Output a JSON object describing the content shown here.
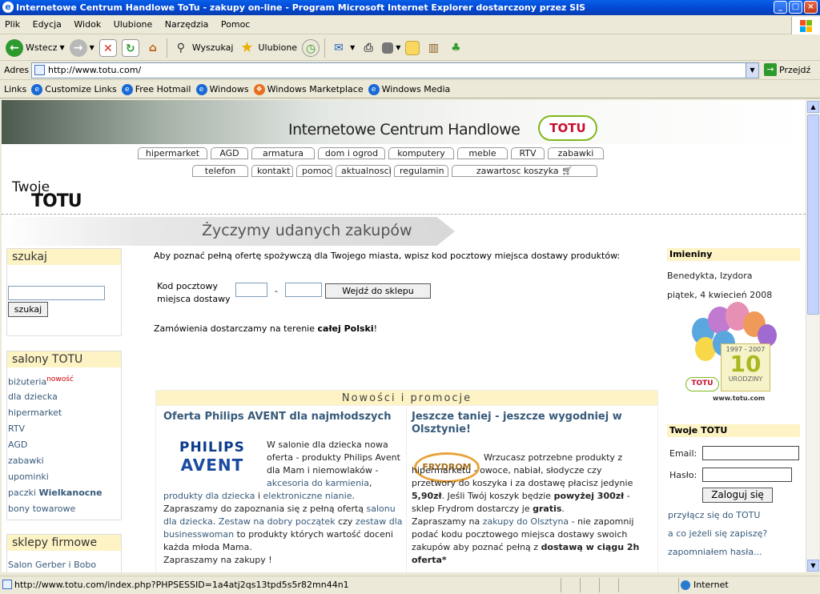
{
  "window": {
    "title": "Internetowe Centrum Handlowe ToTu - zakupy on-line - Program Microsoft Internet Explorer dostarczony przez SIS"
  },
  "menu": [
    "Plik",
    "Edycja",
    "Widok",
    "Ulubione",
    "Narzędzia",
    "Pomoc"
  ],
  "toolbar": {
    "back": "Wstecz",
    "search": "Wyszukaj",
    "favorites": "Ulubione"
  },
  "address": {
    "label": "Adres",
    "url": "http://www.totu.com/",
    "go": "Przejdź"
  },
  "links": {
    "label": "Links",
    "items": [
      "Customize Links",
      "Free Hotmail",
      "Windows",
      "Windows Marketplace",
      "Windows Media"
    ]
  },
  "header": {
    "title": "Internetowe Centrum Handlowe",
    "logo": "TOTU",
    "nav1": [
      "hipermarket",
      "AGD",
      "armatura",
      "dom i ogrod",
      "komputery",
      "meble",
      "RTV",
      "zabawki"
    ],
    "nav2": [
      "telefon",
      "kontakt",
      "pomoc",
      "aktualnosci",
      "regulamin",
      "zawartosc koszyka"
    ],
    "brand_top": "Twoje",
    "brand_bottom": "TOTU",
    "slogan": "Życzymy udanych zakupów"
  },
  "left": {
    "search_title": "szukaj",
    "search_button": "szukaj",
    "salons_title": "salony TOTU",
    "salons": [
      "biżuteria",
      "dla dziecka",
      "hipermarket",
      "RTV",
      "AGD",
      "zabawki",
      "upominki",
      "paczki",
      "bony towarowe"
    ],
    "new_badge": "nowość",
    "paczki_bold": "Wielkanocne",
    "stores_title": "sklepy firmowe",
    "stores": [
      "Salon Gerber i Bobo"
    ]
  },
  "center": {
    "intro": "Aby poznać pełną ofertę spożywczą dla Twojego miasta, wpisz kod pocztowy miejsca dostawy produktów:",
    "postal_label_1": "Kod pocztowy",
    "postal_label_2": "miejsca dostawy",
    "postal_sep": "-",
    "enter_button": "Wejdź do sklepu",
    "delivery_pre": "Zamówienia dostarczamy na terenie ",
    "delivery_bold": "całej Polski",
    "delivery_post": "!",
    "news_title": "Nowości i promocje",
    "news1_title": "Oferta Philips AVENT dla najmłodszych",
    "news1_logo1": "PHILIPS",
    "news1_logo2": "AVENT",
    "news1_text_a": "W salonie dla dziecka nowa oferta - produkty Philips Avent dla Mam i niemowlaków -",
    "news1_link_a": "akcesoria do karmienia",
    "news1_link_b": "produkty dla dziecka",
    "news1_link_c": "elektroniczne nianie",
    "news1_text_b": ". Zapraszamy do zapoznania się z pełną ofertą",
    "news1_link_d": "salonu dla dziecka",
    "news1_link_e": "Zestaw na dobry początek",
    "news1_text_c": "czy",
    "news1_link_f": "zestaw dla businesswoman",
    "news1_text_d": "to produkty których wartość doceni każda młoda Mama.",
    "news1_text_e": "Zapraszamy na zakupy !",
    "news2_title": "Jeszcze taniej - jeszcze wygodniej w Olsztynie!",
    "news2_logo": "FRYDROM",
    "news2_text_a": "Wrzucasz potrzebne produkty z hipermarketu - owoce, nabiał, słodycze czy przetwory do koszyka i za dostawę płacisz jedynie",
    "news2_price": "5,90zł",
    "news2_text_b": ". Jeśli Twój koszyk będzie",
    "news2_above": "powyżej 300zł",
    "news2_text_c": "- sklep Frydrom dostarczy je",
    "news2_free": "gratis",
    "news2_text_d": "Zapraszamy na",
    "news2_link": "zakupy do Olsztyna",
    "news2_text_e": "- nie zapomnij podać kodu pocztowego miejsca dostawy swoich zakupów aby poznać pełną z",
    "news2_bold2": "dostawą w ciągu 2h oferta*"
  },
  "right": {
    "nameday_title": "Imieniny",
    "nameday_names": "Benedykta, Izydora",
    "date": "piątek, 4 kwiecień 2008",
    "anniv_years": "1997 - 2007",
    "anniv_num": "10",
    "anniv_word": "URODZINY",
    "anniv_url": "www.totu.com",
    "login_title": "Twoje TOTU",
    "email_label": "Email:",
    "password_label": "Hasło:",
    "login_button": "Zaloguj się",
    "link_join": "przyłącz się do TOTU",
    "link_why": "a co jeżeli się zapiszę?",
    "link_forgot": "zapomniałem hasła..."
  },
  "status": {
    "text": "http://www.totu.com/index.php?PHPSESSID=1a4atj2qs13tpd5s5r82mn44n1",
    "zone": "Internet"
  }
}
